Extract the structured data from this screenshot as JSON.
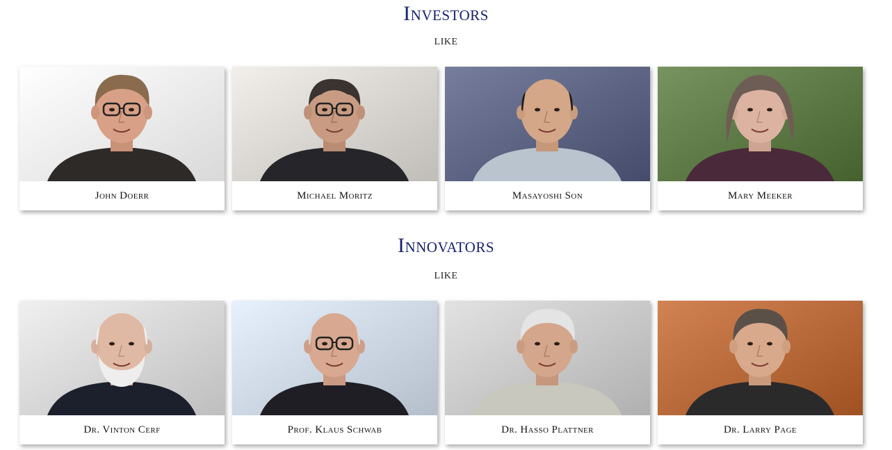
{
  "sections": [
    {
      "title": "Investors",
      "subtitle": "like",
      "people": [
        {
          "name": "John Doerr",
          "bg": "#f2f2f2",
          "skin": "#d9a088",
          "hair": "#8a6b4e",
          "shirt": "#2e2a28",
          "glasses": true,
          "hair_style": "full"
        },
        {
          "name": "Michael Moritz",
          "bg": "#d9d6d2",
          "skin": "#c89b82",
          "hair": "#3a3330",
          "shirt": "#26262a",
          "glasses": true,
          "hair_style": "thin"
        },
        {
          "name": "Masayoshi Son",
          "bg": "#5e6584",
          "skin": "#d3a787",
          "hair": "#1f1c1c",
          "shirt": "#b9c4cf",
          "glasses": false,
          "hair_style": "bald"
        },
        {
          "name": "Mary Meeker",
          "bg": "#5e7a46",
          "skin": "#dcb3a0",
          "hair": "#6e5d55",
          "shirt": "#4a2a3a",
          "glasses": false,
          "hair_style": "bob"
        }
      ]
    },
    {
      "title": "Innovators",
      "subtitle": "like",
      "people": [
        {
          "name": "Dr. Vinton Cerf",
          "bg": "#d7d7d7",
          "skin": "#e0b9a4",
          "hair": "#eeeeee",
          "shirt": "#1c1f2c",
          "glasses": false,
          "hair_style": "bald",
          "beard": true
        },
        {
          "name": "Prof. Klaus Schwab",
          "bg": "#cdd8e4",
          "skin": "#d8a890",
          "hair": "#d8d8d8",
          "shirt": "#1e1e24",
          "glasses": true,
          "hair_style": "bald"
        },
        {
          "name": "Dr. Hasso Plattner",
          "bg": "#c9c9c9",
          "skin": "#d4a68c",
          "hair": "#e4e4e4",
          "shirt": "#c8c8be",
          "glasses": false,
          "hair_style": "full"
        },
        {
          "name": "Dr. Larry Page",
          "bg": "#b86a3a",
          "skin": "#d9a98c",
          "hair": "#5a5048",
          "shirt": "#2a2a2a",
          "glasses": false,
          "hair_style": "full"
        }
      ]
    }
  ]
}
